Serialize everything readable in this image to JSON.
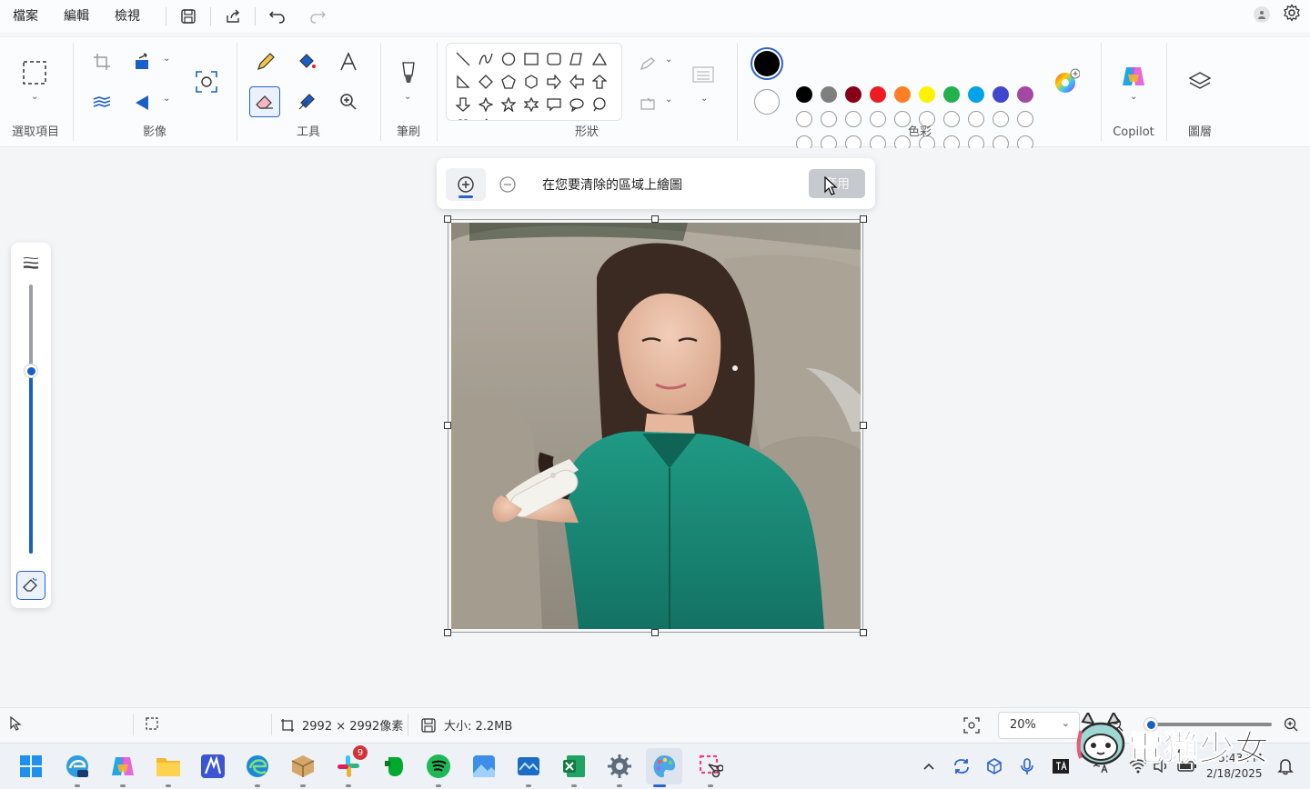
{
  "menu": {
    "file": "檔案",
    "edit": "編輯",
    "view": "檢視"
  },
  "ribbon": {
    "selection_label": "選取項目",
    "image_label": "影像",
    "tools_label": "工具",
    "brushes_label": "筆刷",
    "shapes_label": "形狀",
    "colors_label": "色彩",
    "copilot_label": "Copilot",
    "layers_label": "圖層"
  },
  "colors": {
    "row1": [
      "#000000",
      "#7f7f7f",
      "#880015",
      "#ed1c24",
      "#ff7f27",
      "#fff200",
      "#22b14c",
      "#00a2e8",
      "#3f48cc",
      "#a349a4"
    ],
    "row2": [
      "#ffffff",
      "#c3c3c3",
      "#b97a57",
      "#ffaec9",
      "#ffc90e",
      "#efe4b0",
      "#b5e61d",
      "#99d9ea",
      "#7092be",
      "#c8bfe7"
    ],
    "primary": "#000000",
    "accent": "#2a62c9"
  },
  "erase": {
    "instruction": "在您要清除的區域上繪圖",
    "apply_label": "套用"
  },
  "status": {
    "dimensions": "2992 × 2992像素",
    "size": "大小: 2.2MB",
    "zoom": "20%"
  },
  "brush_size": {
    "level_fraction": 0.68
  },
  "zoom_slider": {
    "level_fraction": 0.02
  },
  "taskbar": {
    "apps": [
      "start-icon",
      "edge-dev-icon",
      "copilot-icon",
      "file-explorer-icon",
      "pen-app-icon",
      "edge-icon",
      "package-icon",
      "slack-icon",
      "evernote-icon",
      "spotify-icon",
      "photos-icon",
      "weather-app-icon",
      "excel-icon",
      "settings-icon",
      "paint-icon",
      "snipping-tool-icon"
    ],
    "slack_badge": "9",
    "clock_time": "5:43 PM",
    "clock_date": "2/18/2025"
  },
  "watermark": {
    "text": "電獺少女"
  }
}
